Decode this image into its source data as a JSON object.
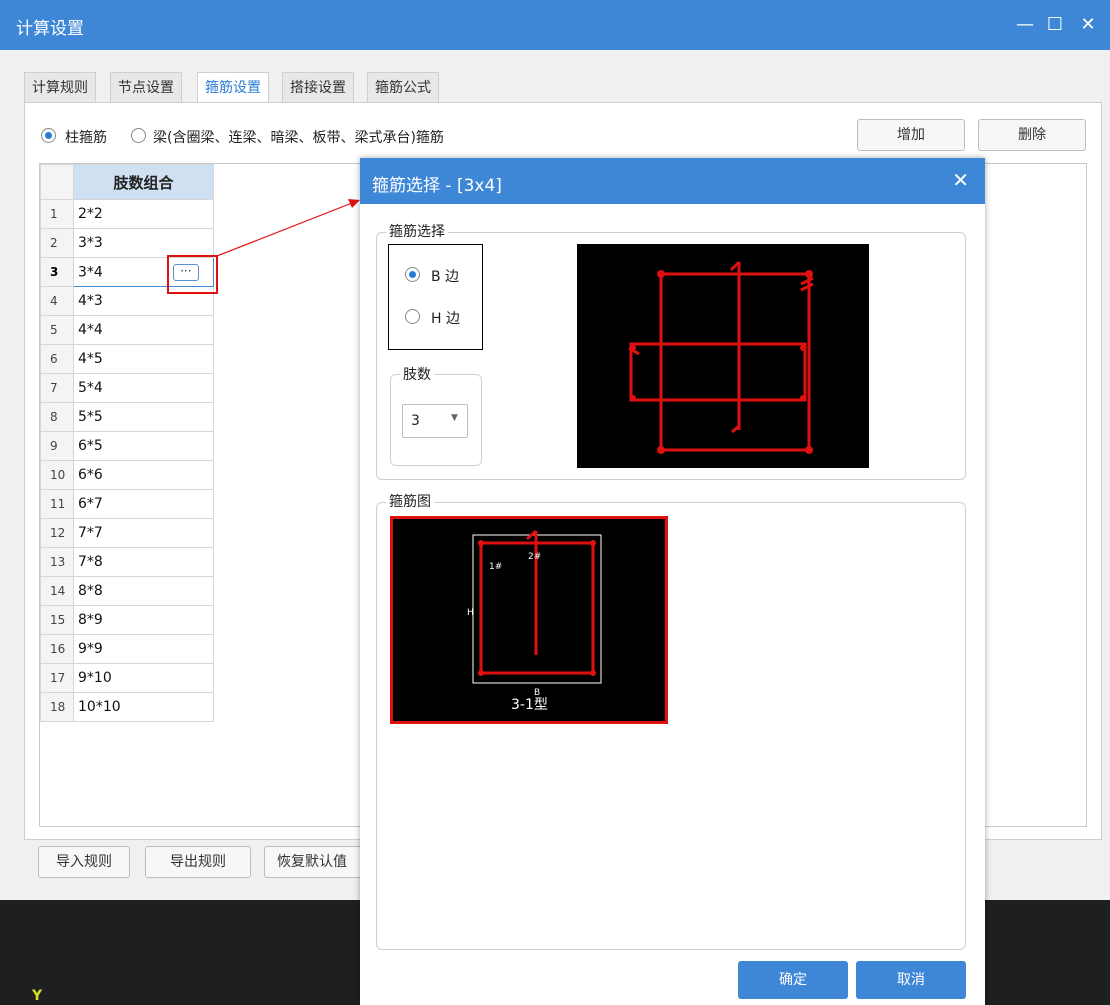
{
  "window": {
    "title": "计算设置"
  },
  "tabs": [
    {
      "label": "计算规则"
    },
    {
      "label": "节点设置"
    },
    {
      "label": "箍筋设置"
    },
    {
      "label": "搭接设置"
    },
    {
      "label": "箍筋公式"
    }
  ],
  "options": {
    "column_label": "柱箍筋",
    "beam_label": "梁(含圈梁、连梁、暗梁、板带、梁式承台)箍筋"
  },
  "toolbar": {
    "add_label": "增加",
    "delete_label": "删除"
  },
  "grid": {
    "header": "肢数组合",
    "rows": [
      {
        "n": "1",
        "v": "2*2"
      },
      {
        "n": "2",
        "v": "3*3"
      },
      {
        "n": "3",
        "v": "3*4"
      },
      {
        "n": "4",
        "v": "4*3"
      },
      {
        "n": "5",
        "v": "4*4"
      },
      {
        "n": "6",
        "v": "4*5"
      },
      {
        "n": "7",
        "v": "5*4"
      },
      {
        "n": "8",
        "v": "5*5"
      },
      {
        "n": "9",
        "v": "6*5"
      },
      {
        "n": "10",
        "v": "6*6"
      },
      {
        "n": "11",
        "v": "6*7"
      },
      {
        "n": "12",
        "v": "7*7"
      },
      {
        "n": "13",
        "v": "7*8"
      },
      {
        "n": "14",
        "v": "8*8"
      },
      {
        "n": "15",
        "v": "8*9"
      },
      {
        "n": "16",
        "v": "9*9"
      },
      {
        "n": "17",
        "v": "9*10"
      },
      {
        "n": "18",
        "v": "10*10"
      }
    ],
    "ellipsis": "···"
  },
  "bottom": {
    "import_label": "导入规则",
    "export_label": "导出规则",
    "restore_label": "恢复默认值"
  },
  "dialog": {
    "title": "箍筋选择 - [3x4]",
    "group1_label": "箍筋选择",
    "b_side": "B 边",
    "h_side": "H 边",
    "legs_label": "肢数",
    "legs_value": "3",
    "group2_label": "箍筋图",
    "diagram": {
      "label_1": "1#",
      "label_2": "2#",
      "label_h": "H",
      "label_b": "B",
      "type_label": "3-1型"
    },
    "ok_label": "确定",
    "cancel_label": "取消"
  },
  "desktop": {
    "axis_label": "Y"
  },
  "colors": {
    "accent": "#3d87d6",
    "rebar": "#e01010",
    "highlight": "#e01010"
  }
}
